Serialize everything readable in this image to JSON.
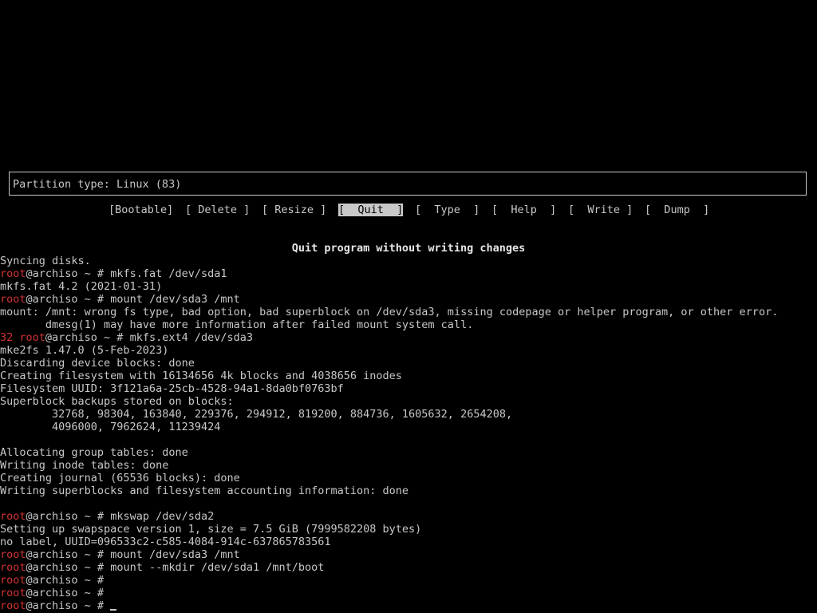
{
  "partition_info": {
    "text": "Partition type: Linux (83)"
  },
  "menu": [
    {
      "label": "[Bootable]",
      "selected": false
    },
    {
      "label": "[ Delete ]",
      "selected": false
    },
    {
      "label": "[ Resize ]",
      "selected": false
    },
    {
      "label": "[  Quit  ]",
      "selected": true
    },
    {
      "label": "[  Type  ]",
      "selected": false
    },
    {
      "label": "[  Help  ]",
      "selected": false
    },
    {
      "label": "[  Write ]",
      "selected": false
    },
    {
      "label": "[  Dump  ]",
      "selected": false
    }
  ],
  "status_message": "Quit program without writing changes",
  "prompt": {
    "user": "root",
    "host_rest": "@archiso ~ # "
  },
  "terminal": {
    "l1": "Syncing disks.",
    "l2_cmd": "mkfs.fat /dev/sda1",
    "l3": "mkfs.fat 4.2 (2021-01-31)",
    "l4_cmd": "mount /dev/sda3 /mnt",
    "l5": "mount: /mnt: wrong fs type, bad option, bad superblock on /dev/sda3, missing codepage or helper program, or other error.",
    "l6": "       dmesg(1) may have more information after failed mount system call.",
    "l7_code": "32 ",
    "l7_cmd": "mkfs.ext4 /dev/sda3",
    "l8": "mke2fs 1.47.0 (5-Feb-2023)",
    "l9": "Discarding device blocks: done",
    "l10": "Creating filesystem with 16134656 4k blocks and 4038656 inodes",
    "l11": "Filesystem UUID: 3f121a6a-25cb-4528-94a1-8da0bf0763bf",
    "l12": "Superblock backups stored on blocks:",
    "l13": "        32768, 98304, 163840, 229376, 294912, 819200, 884736, 1605632, 2654208,",
    "l14": "        4096000, 7962624, 11239424",
    "l16": "Allocating group tables: done",
    "l17": "Writing inode tables: done",
    "l18": "Creating journal (65536 blocks): done",
    "l19": "Writing superblocks and filesystem accounting information: done",
    "l21_cmd": "mkswap /dev/sda2",
    "l22": "Setting up swapspace version 1, size = 7.5 GiB (7999582208 bytes)",
    "l23": "no label, UUID=096533c2-c585-4084-914c-637865783561",
    "l24_cmd": "mount /dev/sda3 /mnt",
    "l25_cmd": "mount --mkdir /dev/sda1 /mnt/boot",
    "l26_cmd": "",
    "l27_cmd": "",
    "l28_cmd": ""
  },
  "colors": {
    "background": "#000000",
    "foreground": "#c8c8c8",
    "prompt_user": "#d23232",
    "selected_bg": "#c8c8c8"
  }
}
